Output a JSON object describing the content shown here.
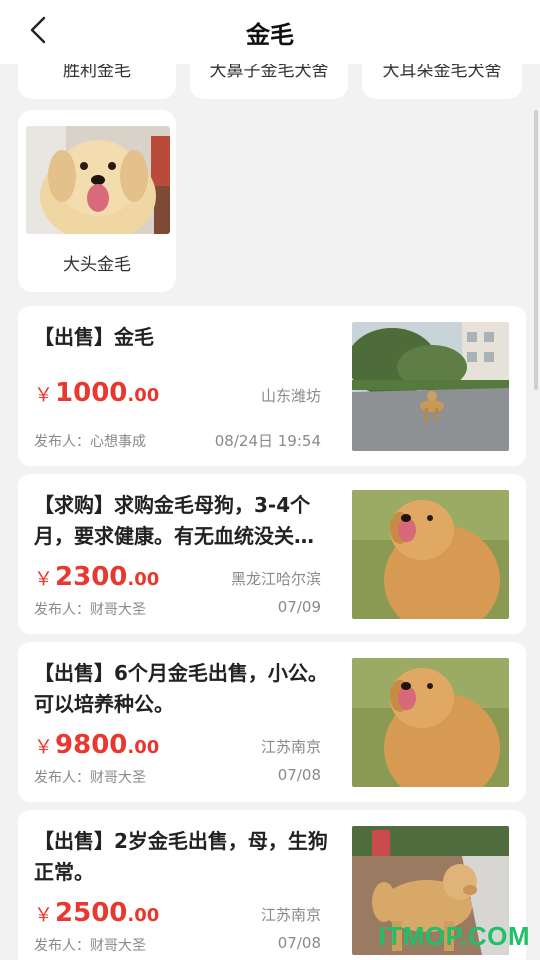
{
  "header": {
    "title": "金毛"
  },
  "categories": [
    {
      "label": "胜利金毛"
    },
    {
      "label": "大鼻子金毛犬舍"
    },
    {
      "label": "大耳朵金毛犬舍"
    },
    {
      "label": "大头金毛"
    }
  ],
  "listings": [
    {
      "title": "【出售】金毛",
      "currency": "￥",
      "price_int": "1000",
      "price_dec": ".00",
      "location": "山东潍坊",
      "publisher": "发布人：心想事成",
      "date": "08/24日 19:54"
    },
    {
      "title": "【求购】求购金毛母狗，3-4个月，要求健康。有无血统没关…",
      "currency": "￥",
      "price_int": "2300",
      "price_dec": ".00",
      "location": "黑龙江哈尔滨",
      "publisher": "发布人：财哥大圣",
      "date": "07/09"
    },
    {
      "title": "【出售】6个月金毛出售，小公。可以培养种公。",
      "currency": "￥",
      "price_int": "9800",
      "price_dec": ".00",
      "location": "江苏南京",
      "publisher": "发布人：财哥大圣",
      "date": "07/08"
    },
    {
      "title": "【出售】2岁金毛出售，母，生狗正常。",
      "currency": "￥",
      "price_int": "2500",
      "price_dec": ".00",
      "location": "江苏南京",
      "publisher": "发布人：财哥大圣",
      "date": "07/08"
    }
  ],
  "watermark": "ITMOP.COM",
  "colors": {
    "price": "#e8382f",
    "background": "#f2f2f2",
    "watermark": "#20c06a"
  }
}
